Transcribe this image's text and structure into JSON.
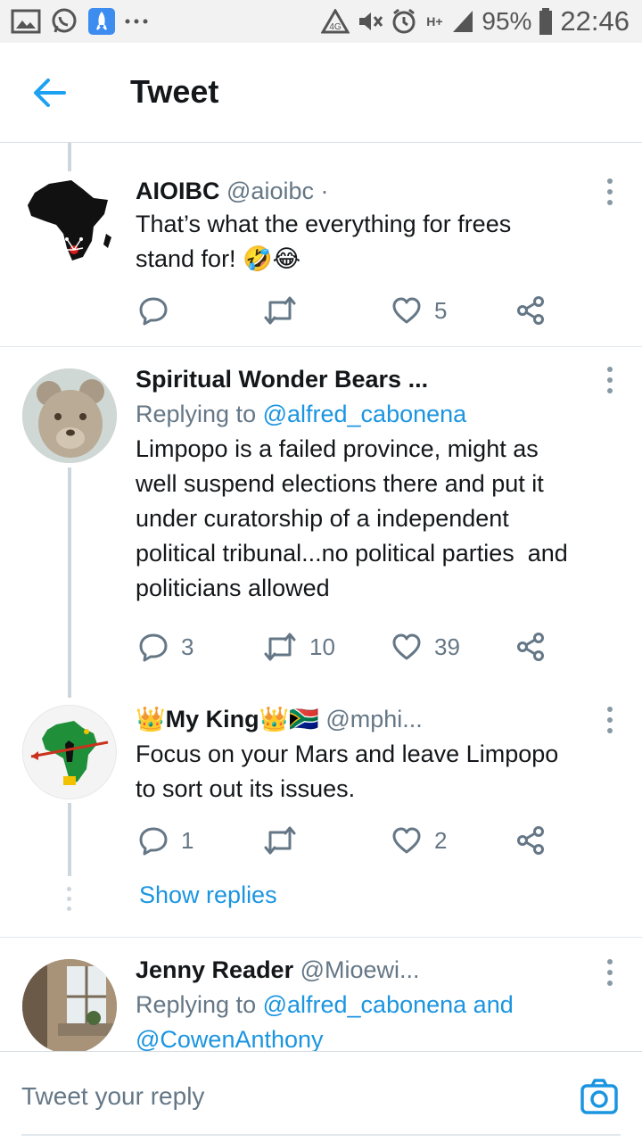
{
  "status_bar": {
    "battery_percent": "95%",
    "time": "22:46",
    "network_label": "H+"
  },
  "header": {
    "title": "Tweet"
  },
  "tweets": [
    {
      "name": "AIOIBC",
      "handle": "@aioibc ·",
      "text_line1": "That’s what the everything for frees",
      "text_line2": "stand for! 🤣😂",
      "reply_count": "",
      "retweet_count": "",
      "like_count": "5"
    },
    {
      "name": "Spiritual Wonder Bears ...",
      "replying_prefix": "Replying to ",
      "replying_to": "@alfred_cabonena",
      "text_lines": [
        "Limpopo is a failed province, might as",
        "well suspend elections there and put it",
        "under curatorship of a independent",
        "political tribunal...no political parties  and",
        "politicians allowed"
      ],
      "reply_count": "3",
      "retweet_count": "10",
      "like_count": "39"
    },
    {
      "name": "👑My King👑🇿🇦",
      "handle": "@mphi...",
      "text_lines": [
        "Focus on your Mars and leave Limpopo",
        "to sort out its issues."
      ],
      "reply_count": "1",
      "retweet_count": "",
      "like_count": "2"
    },
    {
      "name": "Jenny Reader",
      "handle": "@Mioewi...",
      "replying_prefix": "Replying to ",
      "replying_line1": "@alfred_cabonena and",
      "replying_line2": "@CowenAnthony"
    }
  ],
  "show_replies": "Show replies",
  "reply_bar": {
    "placeholder": "Tweet your reply"
  },
  "colors": {
    "link": "#1b95e0",
    "muted": "#657786",
    "text": "#14171a"
  }
}
